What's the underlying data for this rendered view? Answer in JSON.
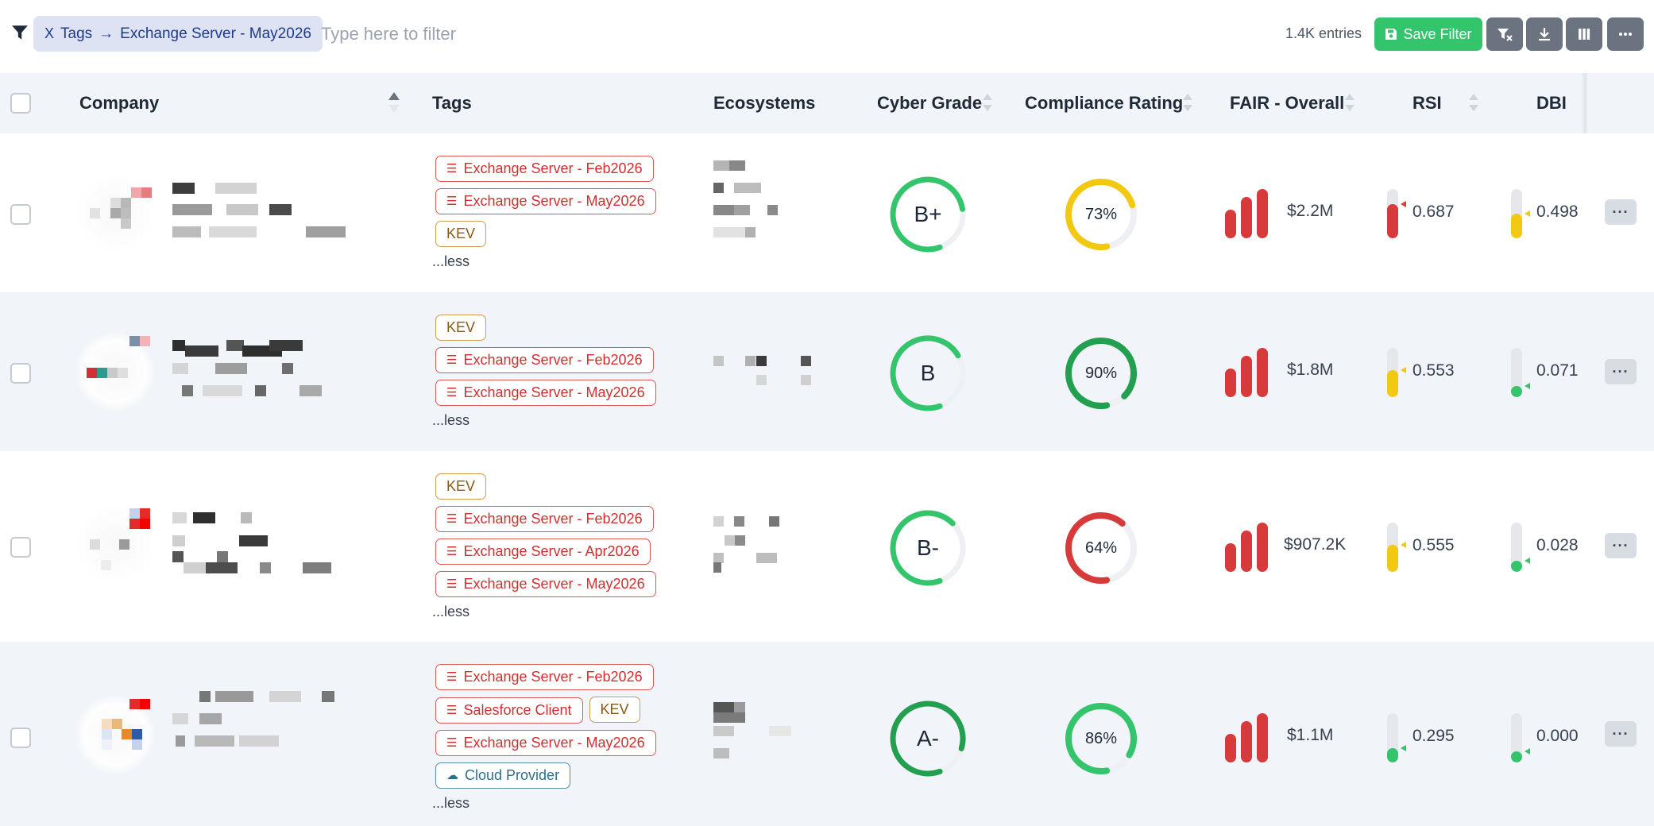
{
  "toolbar": {
    "filter_chip": {
      "x": "X",
      "field": "Tags",
      "arrow": "→",
      "value": "Exchange Server - May2026"
    },
    "filter_placeholder": "Type here to filter",
    "entries": "1.4K entries",
    "save_filter_label": "Save Filter",
    "accent": "#34c46c"
  },
  "columns": {
    "company": "Company",
    "tags": "Tags",
    "ecosystems": "Ecosystems",
    "cyber_grade": "Cyber Grade",
    "compliance": "Compliance Rating",
    "fair": "FAIR - Overall",
    "rsi": "RSI",
    "dbi": "DBI"
  },
  "rows": [
    {
      "tags": [
        {
          "label": "Exchange Server - Feb2026",
          "kind": "red"
        },
        {
          "label": "Exchange Server - May2026",
          "kind": "red"
        },
        {
          "label": "KEV",
          "kind": "kev"
        }
      ],
      "less": "...less",
      "grade": "B+",
      "grade_fraction": 0.78,
      "grade_color": "#34c46c",
      "compliance": "73%",
      "compliance_value": 0.73,
      "compliance_color": "#f2c811",
      "fair": "$2.2M",
      "rsi": "0.687",
      "rsi_level": 0.687,
      "rsi_color": "#d63a3a",
      "dbi": "0.498",
      "dbi_level": 0.498,
      "dbi_color": "#f2c811"
    },
    {
      "tags": [
        {
          "label": "KEV",
          "kind": "kev"
        },
        {
          "label": "Exchange Server - Feb2026",
          "kind": "red"
        },
        {
          "label": "Exchange Server - May2026",
          "kind": "red"
        }
      ],
      "less": "...less",
      "grade": "B",
      "grade_fraction": 0.72,
      "grade_color": "#34c46c",
      "compliance": "90%",
      "compliance_value": 0.9,
      "compliance_color": "#22a04f",
      "fair": "$1.8M",
      "rsi": "0.553",
      "rsi_level": 0.553,
      "rsi_color": "#f2c811",
      "dbi": "0.071",
      "dbi_level": 0.071,
      "dbi_color": "#34c46c"
    },
    {
      "tags": [
        {
          "label": "KEV",
          "kind": "kev"
        },
        {
          "label": "Exchange Server - Feb2026",
          "kind": "red"
        },
        {
          "label": "Exchange Server - Apr2026",
          "kind": "red"
        },
        {
          "label": "Exchange Server - May2026",
          "kind": "red"
        }
      ],
      "less": "...less",
      "grade": "B-",
      "grade_fraction": 0.68,
      "grade_color": "#34c46c",
      "compliance": "64%",
      "compliance_value": 0.64,
      "compliance_color": "#d63a3a",
      "fair": "$907.2K",
      "rsi": "0.555",
      "rsi_level": 0.555,
      "rsi_color": "#f2c811",
      "dbi": "0.028",
      "dbi_level": 0.028,
      "dbi_color": "#34c46c"
    },
    {
      "tags": [
        {
          "label": "Exchange Server - Feb2026",
          "kind": "red"
        },
        {
          "label": "Salesforce Client",
          "kind": "red"
        },
        {
          "label": "KEV",
          "kind": "kev"
        },
        {
          "label": "Exchange Server - May2026",
          "kind": "red"
        },
        {
          "label": "Cloud Provider",
          "kind": "cloud"
        }
      ],
      "less": "...less",
      "grade": "A-",
      "grade_fraction": 0.85,
      "grade_color": "#22a04f",
      "compliance": "86%",
      "compliance_value": 0.86,
      "compliance_color": "#34c46c",
      "fair": "$1.1M",
      "rsi": "0.295",
      "rsi_level": 0.295,
      "rsi_color": "#34c46c",
      "dbi": "0.000",
      "dbi_level": 0.0,
      "dbi_color": "#34c46c"
    }
  ]
}
